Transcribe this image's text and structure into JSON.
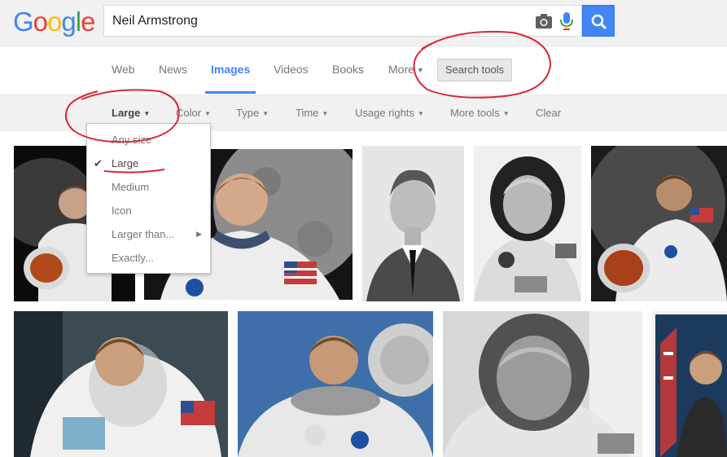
{
  "logo": {
    "letters": [
      "G",
      "o",
      "o",
      "g",
      "l",
      "e"
    ],
    "colors": [
      "#4285f4",
      "#ea4335",
      "#fbbc05",
      "#4285f4",
      "#34a853",
      "#ea4335"
    ]
  },
  "search": {
    "query": "Neil Armstrong"
  },
  "tabs": [
    {
      "label": "Web"
    },
    {
      "label": "News"
    },
    {
      "label": "Images",
      "active": true
    },
    {
      "label": "Videos"
    },
    {
      "label": "Books"
    },
    {
      "label": "More"
    }
  ],
  "search_tools_label": "Search tools",
  "tools": [
    {
      "label": "Large",
      "active": true
    },
    {
      "label": "Color"
    },
    {
      "label": "Type"
    },
    {
      "label": "Time"
    },
    {
      "label": "Usage rights"
    },
    {
      "label": "More tools"
    },
    {
      "label": "Clear"
    }
  ],
  "size_menu": {
    "items": [
      {
        "label": "Any size"
      },
      {
        "label": "Large",
        "checked": true
      },
      {
        "label": "Medium"
      },
      {
        "label": "Icon"
      },
      {
        "label": "Larger than...",
        "submenu": true
      },
      {
        "label": "Exactly..."
      }
    ]
  },
  "results": [
    {
      "description": ""
    },
    {
      "description": ""
    },
    {
      "description": ""
    },
    {
      "description": ""
    },
    {
      "description": ""
    },
    {
      "description": ""
    },
    {
      "description": ""
    },
    {
      "description": ""
    },
    {
      "description": ""
    }
  ],
  "colors": {
    "accent": "#4285f4",
    "annotation": "#d9263a"
  }
}
